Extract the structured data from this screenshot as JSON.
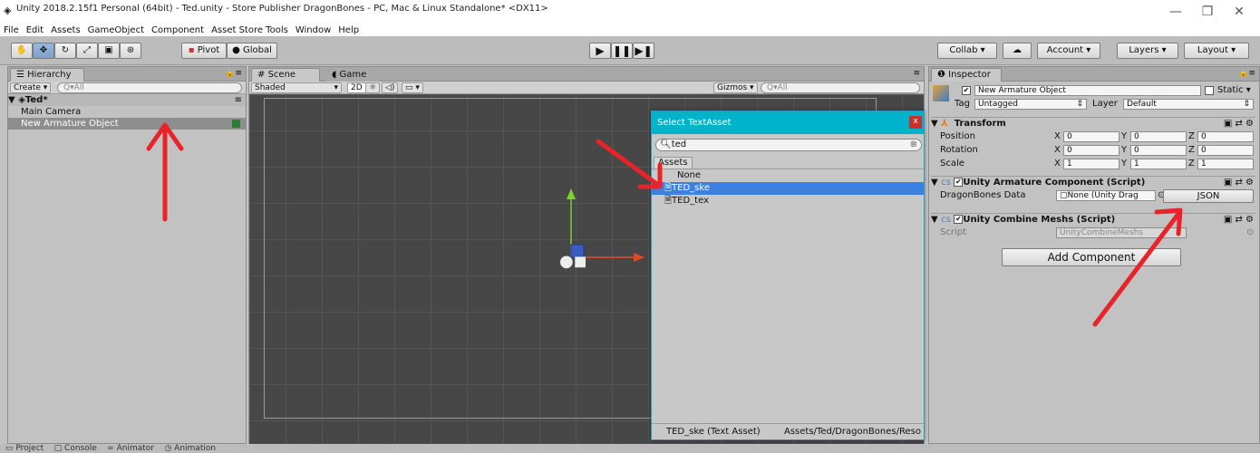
{
  "window": {
    "title": "Unity 2018.2.15f1 Personal (64bit) - Ted.unity - Store Publisher DragonBones - PC, Mac & Linux Standalone* <DX11>",
    "minimize": "—",
    "maximize": "❐",
    "close": "✕"
  },
  "menu": [
    "File",
    "Edit",
    "Assets",
    "GameObject",
    "Component",
    "Asset Store Tools",
    "Window",
    "Help"
  ],
  "toolbar": {
    "pivot": "Pivot",
    "global": "Global",
    "collab": "Collab ▾",
    "account": "Account",
    "layers": "Layers",
    "layout": "Layout"
  },
  "hierarchy": {
    "tab": "Hierarchy",
    "create": "Create",
    "search_placeholder": "Q▾All",
    "scene_name": "Ted*",
    "items": [
      "Main Camera",
      "New Armature Object"
    ]
  },
  "scene": {
    "tab_scene": "Scene",
    "tab_game": "Game",
    "shading": "Shaded",
    "mode_2d": "2D",
    "gizmos": "Gizmos",
    "search_placeholder": "Q▾All"
  },
  "inspector": {
    "tab": "Inspector",
    "object_name": "New Armature Object",
    "static_label": "Static",
    "tag_label": "Tag",
    "tag_value": "Untagged",
    "layer_label": "Layer",
    "layer_value": "Default",
    "transform": {
      "title": "Transform",
      "rows": [
        {
          "label": "Position",
          "x": "0",
          "y": "0",
          "z": "0"
        },
        {
          "label": "Rotation",
          "x": "0",
          "y": "0",
          "z": "0"
        },
        {
          "label": "Scale",
          "x": "1",
          "y": "1",
          "z": "1"
        }
      ]
    },
    "armature": {
      "title": "Unity Armature Component (Script)",
      "field_label": "DragonBones Data",
      "field_value": "None (Unity Drag",
      "json_button": "JSON"
    },
    "combine": {
      "title": "Unity Combine Meshs (Script)",
      "script_label": "Script",
      "script_value": "UnityCombineMeshs"
    },
    "add_component": "Add Component"
  },
  "dialog": {
    "title": "Select TextAsset",
    "close": "x",
    "search_value": "ted",
    "assets_tab": "Assets",
    "items": [
      "None",
      "TED_ske",
      "TED_tex"
    ],
    "selected_index": 1,
    "footer_left": "TED_ske (Text Asset)",
    "footer_right": "Assets/Ted/DragonBones/Reso"
  },
  "bottom": {
    "project_tab": "Project",
    "console_tab": "Console",
    "animator_tab": "Animator",
    "animation_tab": "Animation"
  },
  "colors": {
    "arrow": "#e8232a",
    "selection": "#3d80df",
    "dialog_title": "#00b3cc"
  }
}
